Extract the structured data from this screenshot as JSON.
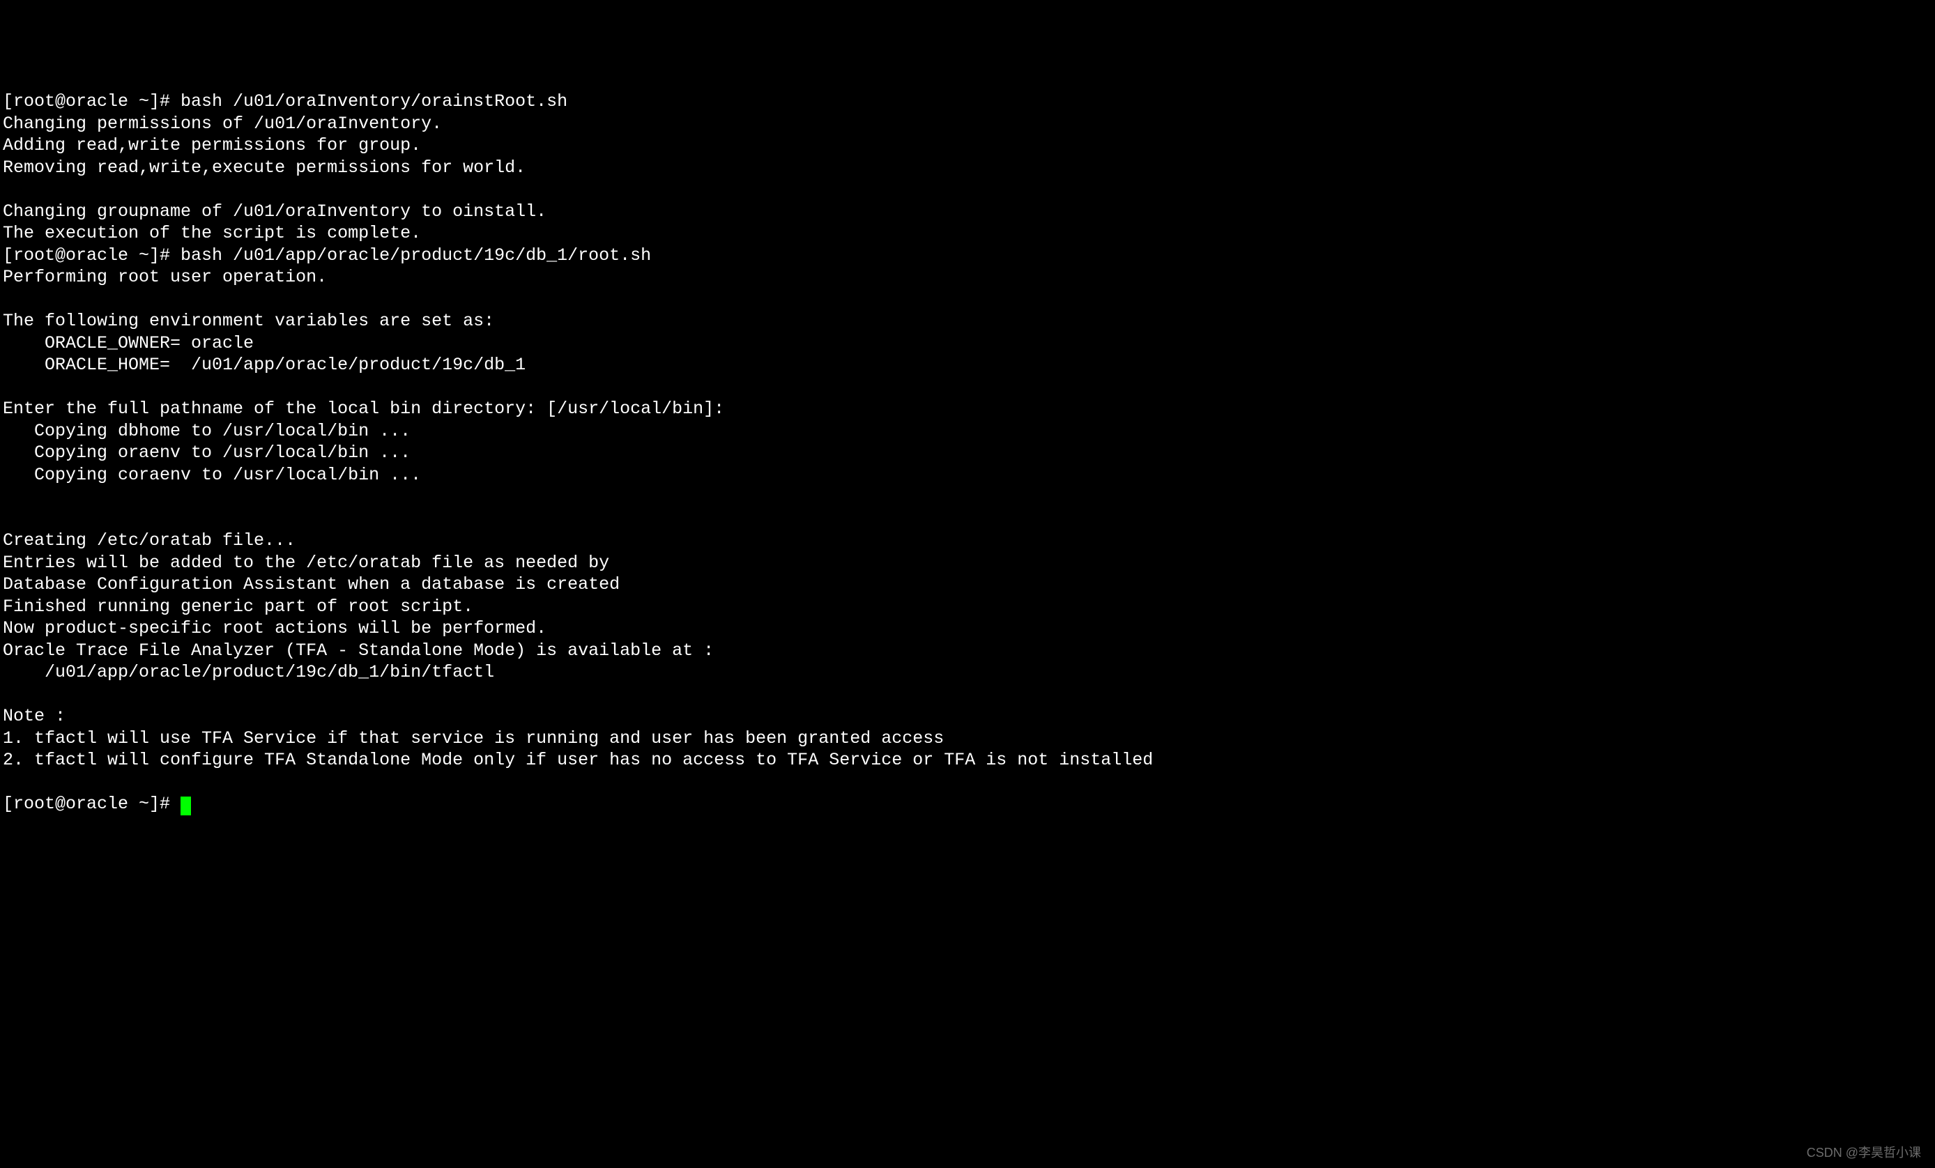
{
  "terminal": {
    "lines": [
      "[root@oracle ~]# bash /u01/oraInventory/orainstRoot.sh",
      "Changing permissions of /u01/oraInventory.",
      "Adding read,write permissions for group.",
      "Removing read,write,execute permissions for world.",
      "",
      "Changing groupname of /u01/oraInventory to oinstall.",
      "The execution of the script is complete.",
      "[root@oracle ~]# bash /u01/app/oracle/product/19c/db_1/root.sh",
      "Performing root user operation.",
      "",
      "The following environment variables are set as:",
      "    ORACLE_OWNER= oracle",
      "    ORACLE_HOME=  /u01/app/oracle/product/19c/db_1",
      "",
      "Enter the full pathname of the local bin directory: [/usr/local/bin]:",
      "   Copying dbhome to /usr/local/bin ...",
      "   Copying oraenv to /usr/local/bin ...",
      "   Copying coraenv to /usr/local/bin ...",
      "",
      "",
      "Creating /etc/oratab file...",
      "Entries will be added to the /etc/oratab file as needed by",
      "Database Configuration Assistant when a database is created",
      "Finished running generic part of root script.",
      "Now product-specific root actions will be performed.",
      "Oracle Trace File Analyzer (TFA - Standalone Mode) is available at :",
      "    /u01/app/oracle/product/19c/db_1/bin/tfactl",
      "",
      "Note :",
      "1. tfactl will use TFA Service if that service is running and user has been granted access",
      "2. tfactl will configure TFA Standalone Mode only if user has no access to TFA Service or TFA is not installed",
      "",
      "[root@oracle ~]# "
    ],
    "prompt": "[root@oracle ~]# ",
    "cursor_visible": true
  },
  "watermark": "CSDN @李昊哲小课"
}
